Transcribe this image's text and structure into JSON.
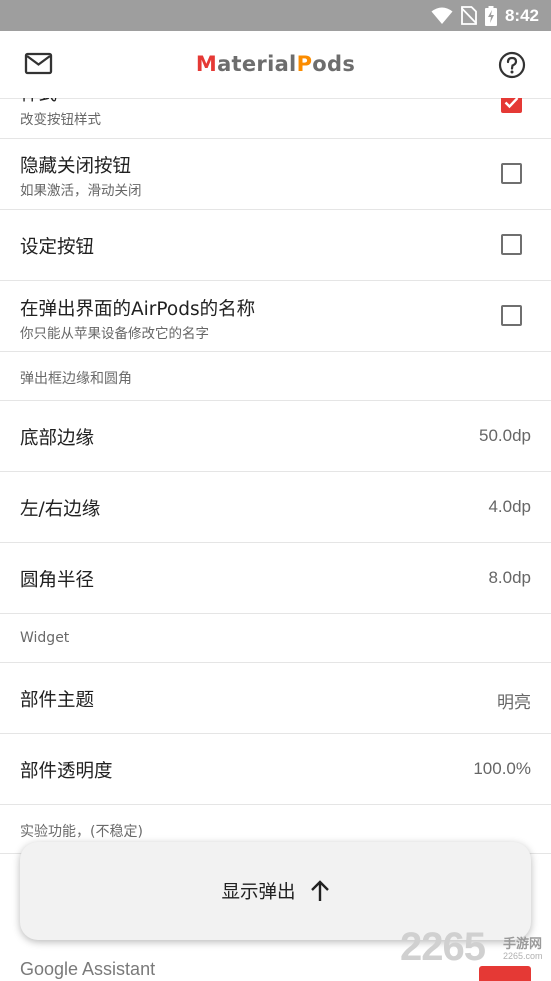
{
  "status_bar": {
    "time": "8:42",
    "icons": [
      "wifi-icon",
      "no-sim-icon",
      "battery-charging-icon"
    ]
  },
  "toolbar": {
    "title_part1": "Material",
    "title_part2": "Pods",
    "left_icon": "mail-icon",
    "right_icon": "help-icon"
  },
  "settings": {
    "rows": [
      {
        "title": "样式",
        "subtitle": "改变按钮样式",
        "checked": true
      },
      {
        "title": "隐藏关闭按钮",
        "subtitle": "如果激活，滑动关闭",
        "checked": false
      },
      {
        "title": "设定按钮",
        "checked": false
      },
      {
        "title": "在弹出界面的AirPods的名称",
        "subtitle": "你只能从苹果设备修改它的名字",
        "checked": false
      }
    ],
    "section_popup": "弹出框边缘和圆角",
    "popup_items": [
      {
        "title": "底部边缘",
        "value": "50.0dp"
      },
      {
        "title": "左/右边缘",
        "value": "4.0dp"
      },
      {
        "title": "圆角半径",
        "value": "8.0dp"
      }
    ],
    "section_widget": "Widget",
    "widget_items": [
      {
        "title": "部件主题",
        "value": "明亮"
      },
      {
        "title": "部件透明度",
        "value": "100.0%"
      }
    ],
    "section_experimental": "实验功能，(不稳定)",
    "google_assistant": "Google Assistant"
  },
  "popup_button": {
    "label": "显示弹出",
    "icon": "arrow-up-icon"
  },
  "watermark": {
    "number": "2265",
    "site_cn": "手游网",
    "url": "2265.com"
  },
  "colors": {
    "accent": "#e53935",
    "status_bar": "#9e9e9e",
    "title_orange": "#fb8c00"
  }
}
